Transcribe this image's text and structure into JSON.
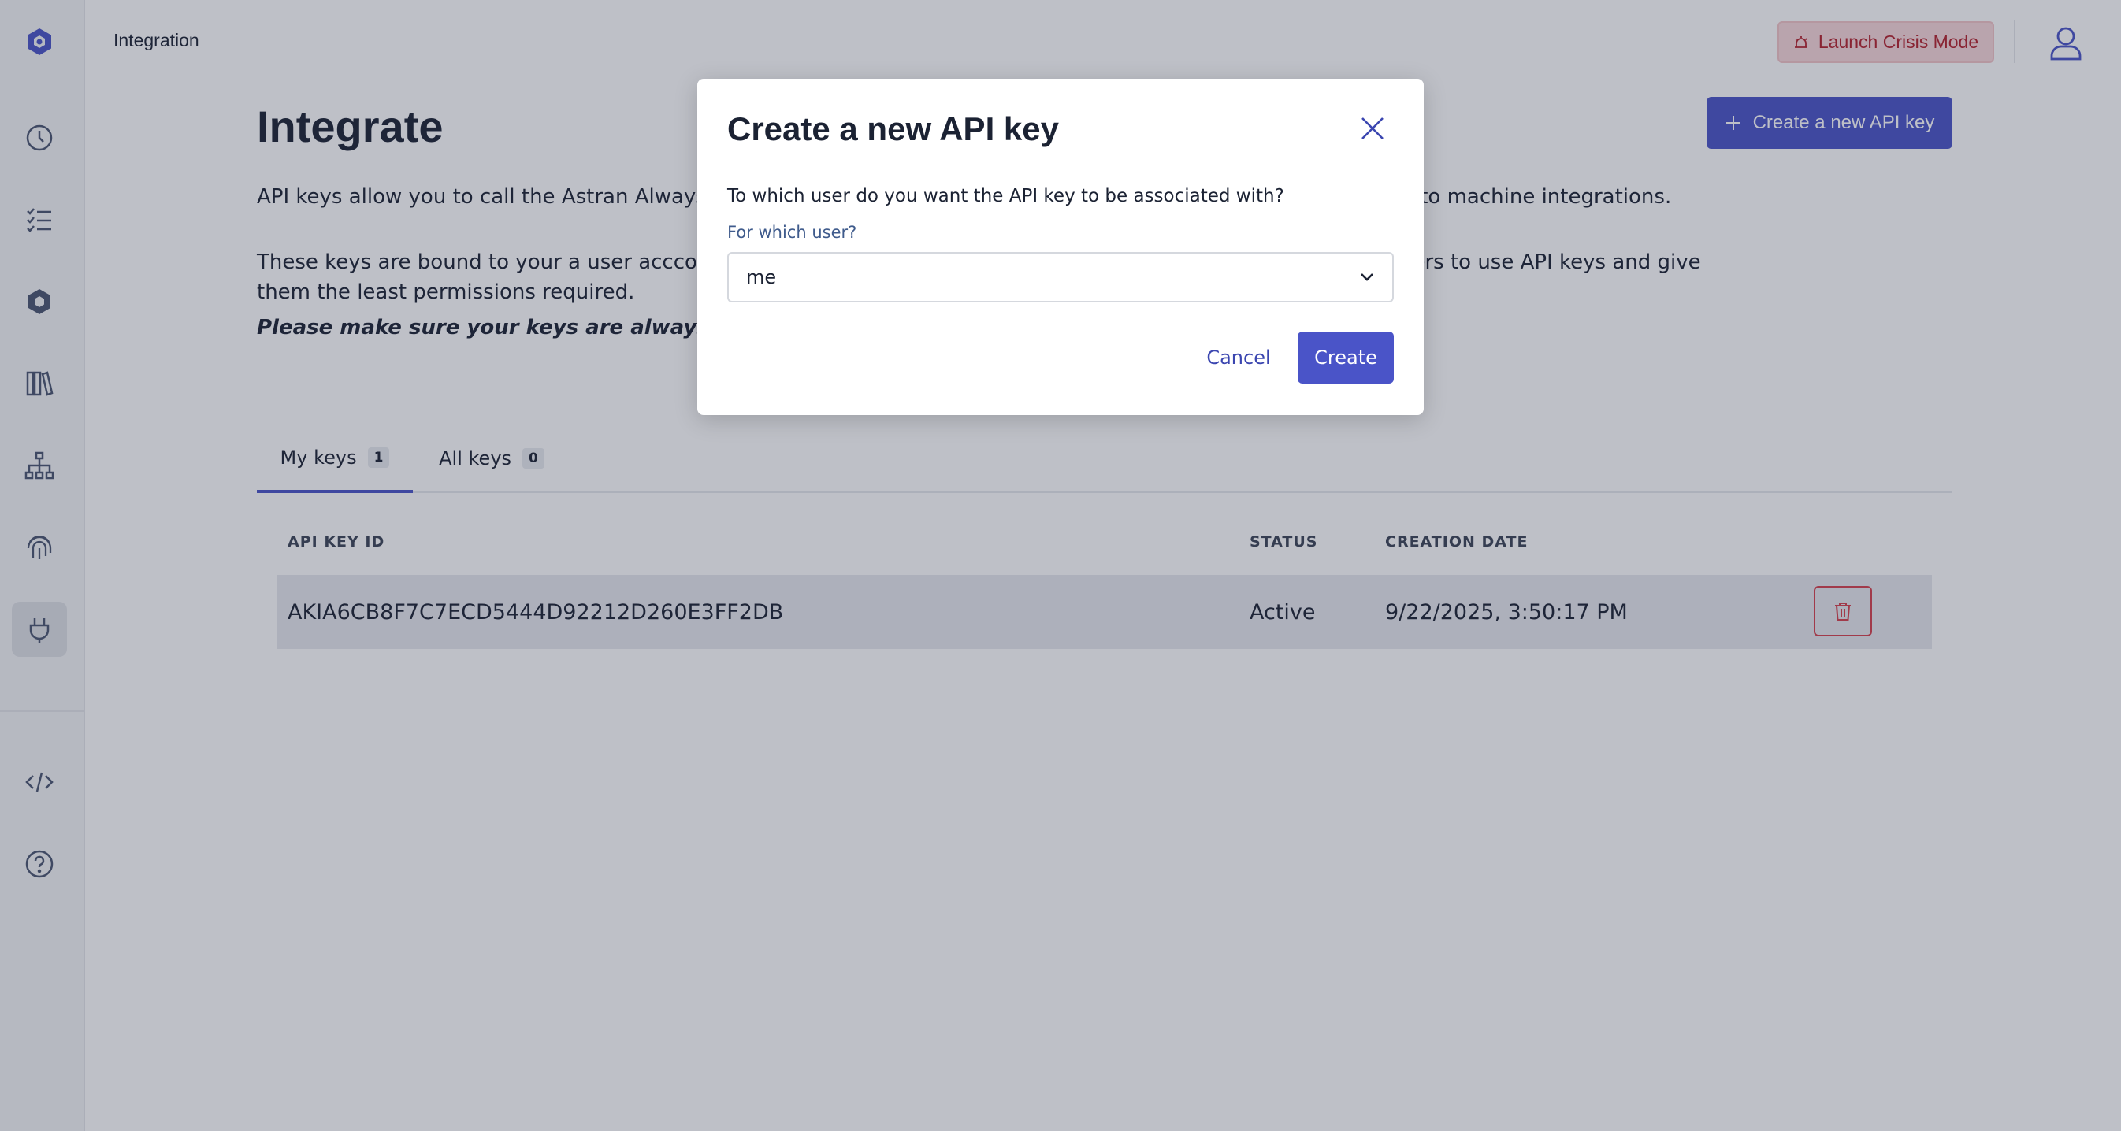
{
  "topbar": {
    "breadcrumb": "Integration",
    "crisis_button": "Launch Crisis Mode"
  },
  "page": {
    "title": "Integrate",
    "create_button": "Create a new API key",
    "description_line1": "API keys allow you to call the Astran AlwaysReady API programmatically. They are meant to be used for machine to machine integrations.",
    "description_line2": "These keys are bound to your a user acccount and inherit its permissions. We recommend creating dedicated users to use API keys and give them the least permissions required.",
    "description_line3": "Please make sure your keys are always secure."
  },
  "tabs": [
    {
      "label": "My keys",
      "count": "1"
    },
    {
      "label": "All keys",
      "count": "0"
    }
  ],
  "table": {
    "headers": [
      "API KEY ID",
      "STATUS",
      "CREATION DATE"
    ],
    "rows": [
      {
        "id": "AKIA6CB8F7C7ECD5444D92212D260E3FF2DB",
        "status": "Active",
        "created": "9/22/2025, 3:50:17 PM"
      }
    ]
  },
  "modal": {
    "title": "Create a new API key",
    "question": "To which user do you want the API key to be associated with?",
    "field_label": "For which user?",
    "selected_user": "me",
    "cancel": "Cancel",
    "create": "Create"
  },
  "colors": {
    "accent": "#4a54c8",
    "danger": "#d6404c",
    "sidebar_icon": "#4a54c8"
  }
}
